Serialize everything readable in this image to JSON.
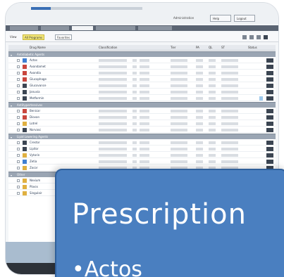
{
  "header": {
    "links": [
      "Administration",
      "Help",
      "Logout"
    ]
  },
  "tabs": [
    "",
    "",
    "",
    "",
    ""
  ],
  "toolbar": {
    "view_label": "View",
    "filter_label": "All Programs",
    "option_label": "Favorites"
  },
  "table": {
    "columns": [
      "Drug Name",
      "Classification",
      "Tier",
      "PA",
      "QL",
      "ST",
      "Status"
    ],
    "groups": [
      {
        "title": "Antidiabetic Agents",
        "rows": [
          {
            "name": "Actos",
            "icon_color": "#3f7fd1",
            "flag": false
          },
          {
            "name": "Avandamet",
            "icon_color": "#c9463d",
            "flag": false
          },
          {
            "name": "Avandia",
            "icon_color": "#c9463d",
            "flag": false
          },
          {
            "name": "Glucophage",
            "icon_color": "#c9463d",
            "flag": false
          },
          {
            "name": "Glucovance",
            "icon_color": "#3b4552",
            "flag": false
          },
          {
            "name": "Januvia",
            "icon_color": "#3b4552",
            "flag": false
          },
          {
            "name": "Metformin",
            "icon_color": "#3b4552",
            "flag": true
          }
        ]
      },
      {
        "title": "Antihypertensives",
        "rows": [
          {
            "name": "Benicar",
            "icon_color": "#c9463d",
            "flag": false
          },
          {
            "name": "Diovan",
            "icon_color": "#c9463d",
            "flag": false
          },
          {
            "name": "Lotrel",
            "icon_color": "#e0b040",
            "flag": false
          },
          {
            "name": "Norvasc",
            "icon_color": "#3b4552",
            "flag": false
          }
        ]
      },
      {
        "title": "Lipid Lowering Agents",
        "rows": [
          {
            "name": "Crestor",
            "icon_color": "#3b4552",
            "flag": false
          },
          {
            "name": "Lipitor",
            "icon_color": "#3b4552",
            "flag": false
          },
          {
            "name": "Vytorin",
            "icon_color": "#e0b040",
            "flag": false
          },
          {
            "name": "Zetia",
            "icon_color": "#3f7fd1",
            "flag": false
          },
          {
            "name": "Zocor",
            "icon_color": "#e0b040",
            "flag": false
          }
        ]
      },
      {
        "title": "Other",
        "rows": [
          {
            "name": "Nexium",
            "icon_color": "#e0b040",
            "flag": false
          },
          {
            "name": "Plavix",
            "icon_color": "#e0b040",
            "flag": false
          },
          {
            "name": "Singulair",
            "icon_color": "#e0b040",
            "flag": false
          }
        ]
      }
    ]
  },
  "slide": {
    "title": "Prescription",
    "bullet": "•Actos"
  },
  "colors": {
    "slide_bg": "#4a7fc0",
    "group_bar": "#9aa5b3",
    "accent": "#3a6fb5"
  }
}
